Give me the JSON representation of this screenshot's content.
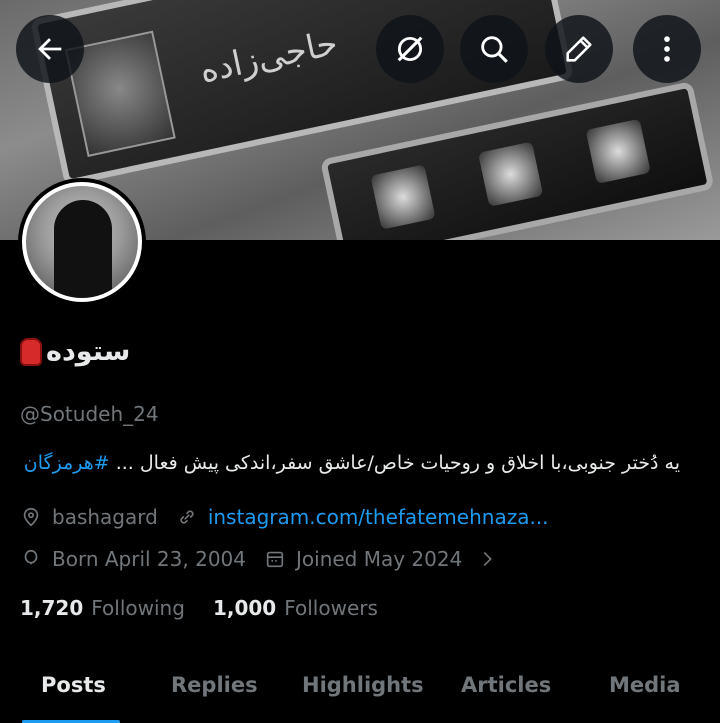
{
  "banner": {
    "plate_text": "حاجی‌زاده"
  },
  "header": {
    "back_icon": "arrow-left-icon",
    "grok_icon": "grok-icon",
    "search_icon": "search-icon",
    "edit_icon": "pencil-icon",
    "more_icon": "more-vertical-icon"
  },
  "profile": {
    "name": "ستوده",
    "handle": "@Sotudeh_24",
    "bio_text": "یه دُختر جنوبی،با اخلاق و روحیات خاص/عاشق سفر،اندکی پیش فعال ... ",
    "bio_hashtag": "#هرمزگان",
    "location": "bashagard",
    "website": "instagram.com/thefatemehnaza...",
    "birthday": "Born April 23, 2004",
    "joined": "Joined May 2024",
    "following_count": "1,720",
    "following_label": "Following",
    "followers_count": "1,000",
    "followers_label": "Followers"
  },
  "tabs": [
    {
      "label": "Posts",
      "active": true
    },
    {
      "label": "Replies",
      "active": false
    },
    {
      "label": "Highlights",
      "active": false
    },
    {
      "label": "Articles",
      "active": false
    },
    {
      "label": "Media",
      "active": false
    }
  ],
  "colors": {
    "accent": "#1d9bf0",
    "muted": "#71767b",
    "text": "#e7e9ea",
    "background": "#000000"
  }
}
